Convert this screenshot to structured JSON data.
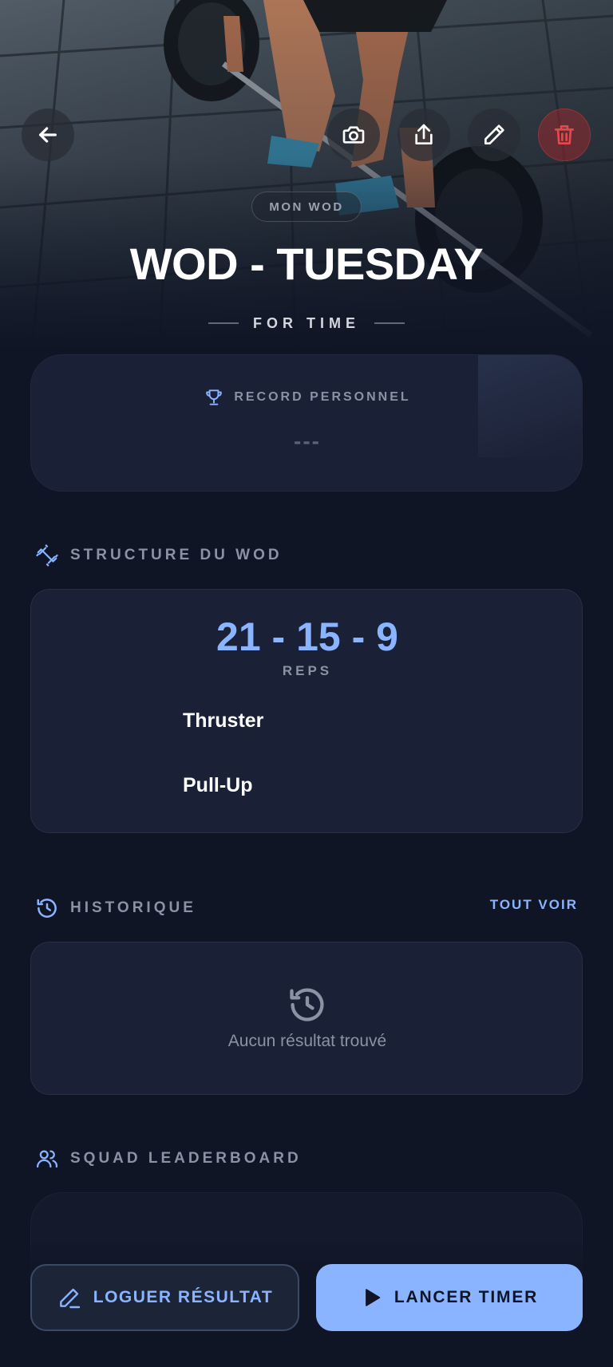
{
  "hero": {
    "tag": "MON WOD",
    "title": "WOD - TUESDAY",
    "type": "FOR TIME",
    "photo": "barbell-deadlift-photo"
  },
  "toolbar": {
    "back_icon": "arrow-left-icon",
    "camera_icon": "camera-icon",
    "share_icon": "share-icon",
    "edit_icon": "pencil-icon",
    "delete_icon": "trash-icon"
  },
  "record": {
    "label": "RECORD PERSONNEL",
    "value": "---",
    "icon": "trophy-icon"
  },
  "structure": {
    "heading": "STRUCTURE DU WOD",
    "icon": "dumbbell-icon",
    "scheme": "21 - 15 - 9",
    "unit": "REPS",
    "movements": [
      "Thruster",
      "Pull-Up"
    ]
  },
  "history": {
    "heading": "HISTORIQUE",
    "icon": "history-icon",
    "see_all": "TOUT VOIR",
    "empty_text": "Aucun résultat trouvé"
  },
  "leaderboard": {
    "heading": "SQUAD LEADERBOARD",
    "icon": "users-icon"
  },
  "actions": {
    "log_label": "LOGUER RÉSULTAT",
    "timer_label": "LANCER TIMER"
  },
  "colors": {
    "background": "#0f1525",
    "card": "#1a2035",
    "accent": "#8ab4ff",
    "muted": "#8a92a3",
    "danger": "#e5484d"
  }
}
